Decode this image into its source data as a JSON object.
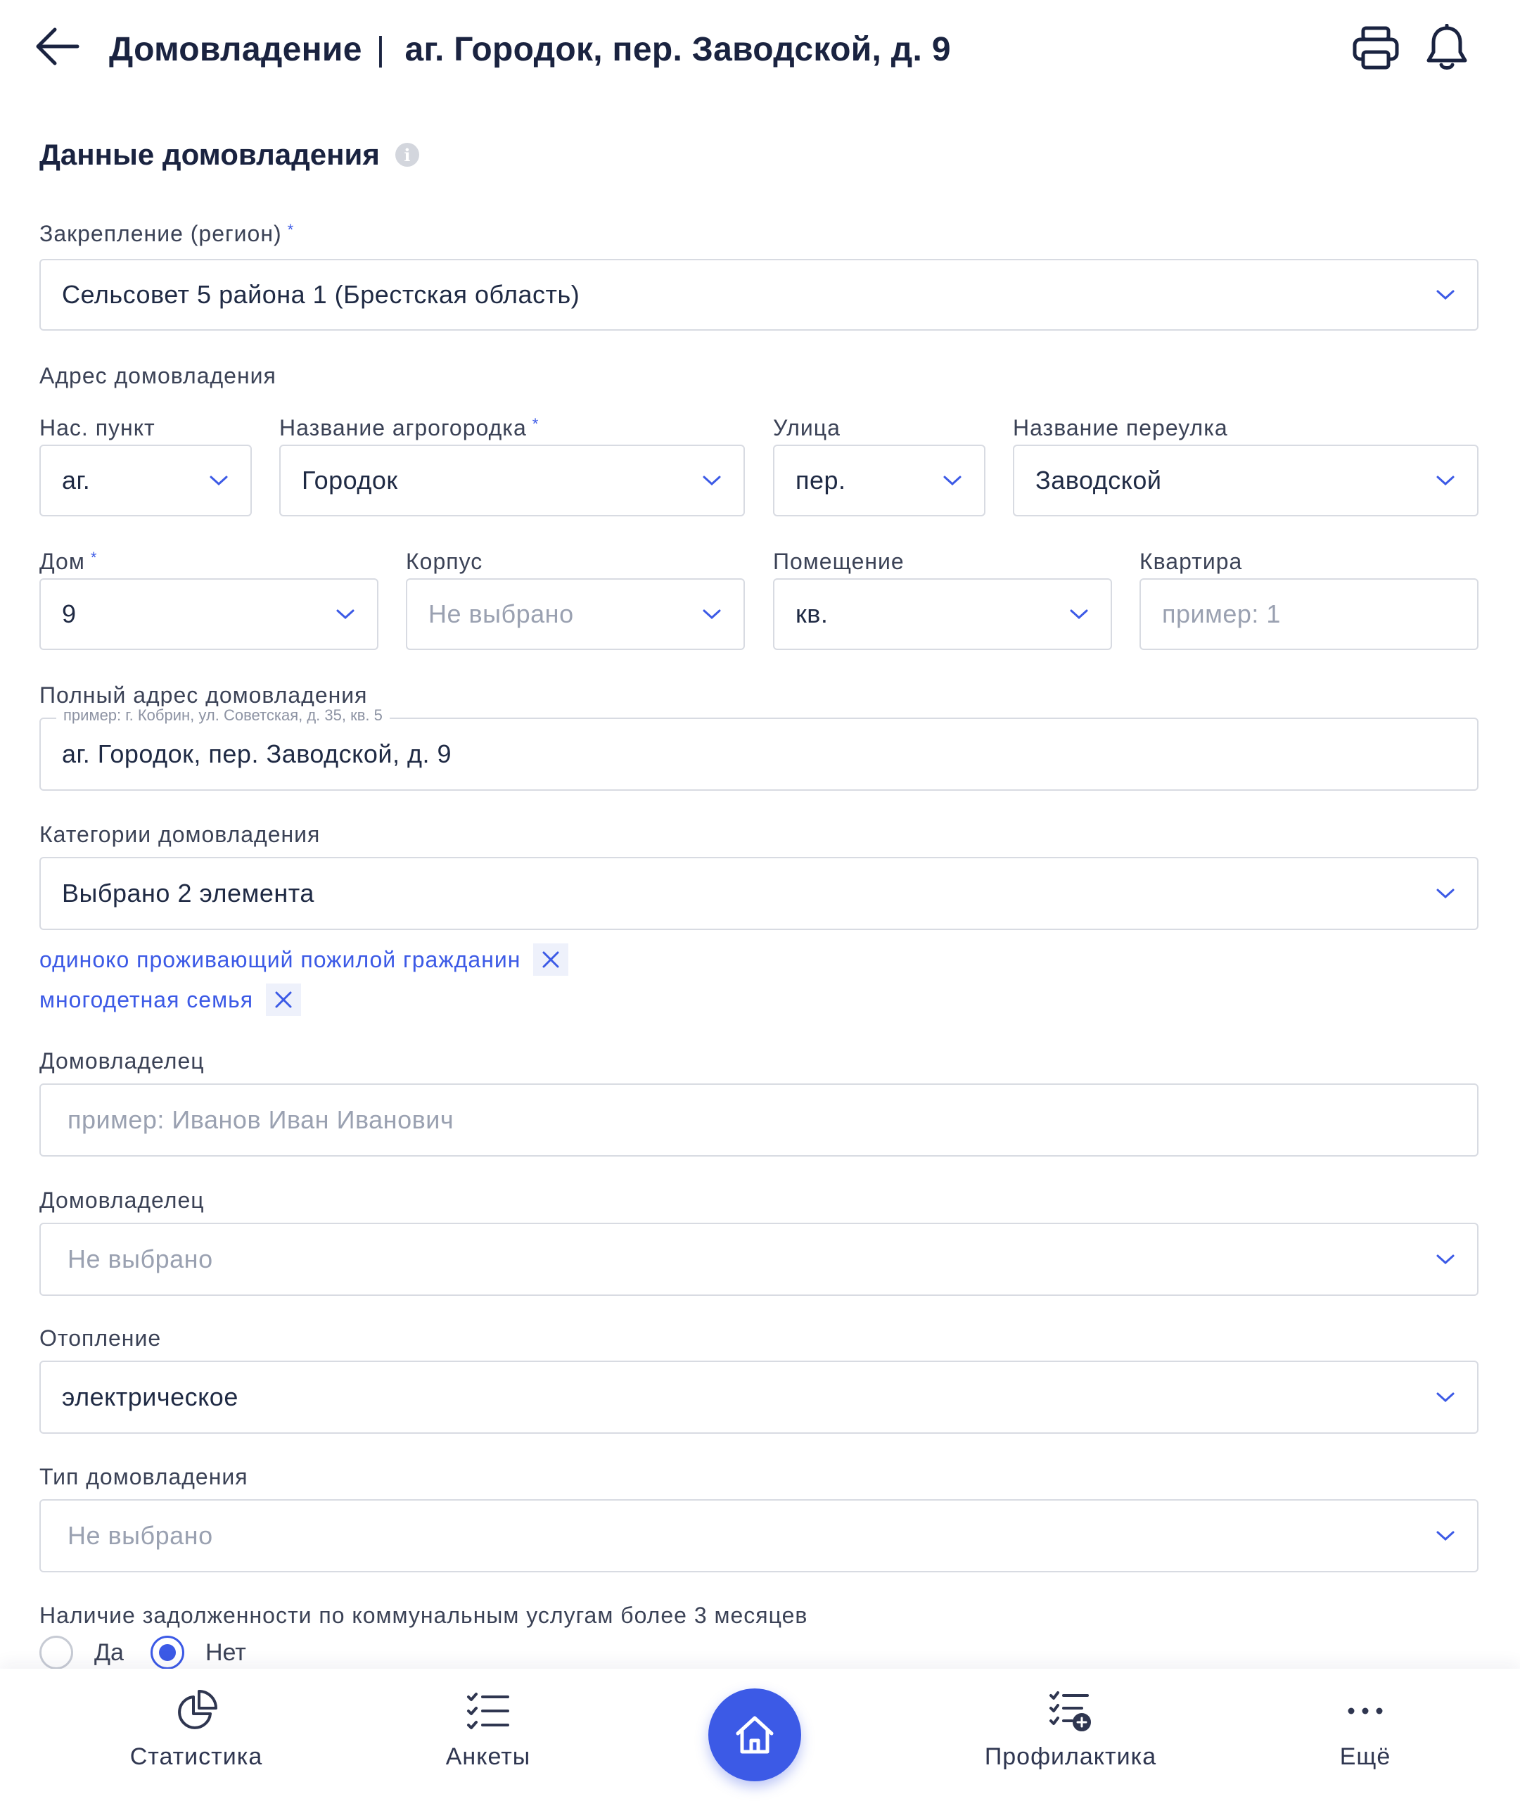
{
  "header": {
    "title_prefix": "Домовладение",
    "title_separator": "|",
    "title_address": "аг. Городок, пер. Заводской, д. 9"
  },
  "section": {
    "title": "Данные домовладения",
    "info_glyph": "i"
  },
  "region": {
    "label": "Закрепление (регион)",
    "required_mark": "*",
    "value": "Сельсовет 5 района 1 (Брестская область)"
  },
  "address_title": "Адрес домовладения",
  "settlement": {
    "label": "Нас. пункт",
    "value": "аг."
  },
  "agrotown": {
    "label": "Название агрогородка",
    "required_mark": "*",
    "value": "Городок"
  },
  "street": {
    "label": "Улица",
    "value": "пер."
  },
  "lane": {
    "label": "Название переулка",
    "value": "Заводской"
  },
  "house": {
    "label": "Дом",
    "required_mark": "*",
    "value": "9"
  },
  "building": {
    "label": "Корпус",
    "placeholder": "Не выбрано"
  },
  "premises": {
    "label": "Помещение",
    "value": "кв."
  },
  "apartment": {
    "label": "Квартира",
    "placeholder": "пример: 1"
  },
  "full_address": {
    "label": "Полный адрес домовладения",
    "hint": "пример: г. Кобрин, ул. Советская, д. 35, кв. 5",
    "value": "аг. Городок, пер. Заводской, д. 9"
  },
  "categories": {
    "label": "Категории домовладения",
    "value": "Выбрано 2 элемента",
    "tags": [
      "одиноко проживающий пожилой гражданин",
      "многодетная семья"
    ]
  },
  "owner_text": {
    "label": "Домовладелец",
    "placeholder": "пример: Иванов Иван Иванович"
  },
  "owner_select": {
    "label": "Домовладелец",
    "placeholder": "Не выбрано"
  },
  "heating": {
    "label": "Отопление",
    "value": "электрическое"
  },
  "house_type": {
    "label": "Тип домовладения",
    "placeholder": "Не выбрано"
  },
  "debt": {
    "label": "Наличие задолженности по коммунальным услугам более 3 месяцев",
    "options": [
      "Да",
      "Нет"
    ],
    "selected": "Нет"
  },
  "nav": {
    "items": [
      {
        "label": "Статистика",
        "icon": "pie-chart-icon"
      },
      {
        "label": "Анкеты",
        "icon": "checklist-icon"
      },
      {
        "label": "",
        "icon": "home-icon"
      },
      {
        "label": "Профилактика",
        "icon": "checklist-add-icon"
      },
      {
        "label": "Ещё",
        "icon": "more-dots-icon"
      }
    ]
  },
  "colors": {
    "accent": "#3c5ae6",
    "text": "#1f2a44",
    "border": "#d8dbe2",
    "placeholder": "#9aa1b1"
  }
}
